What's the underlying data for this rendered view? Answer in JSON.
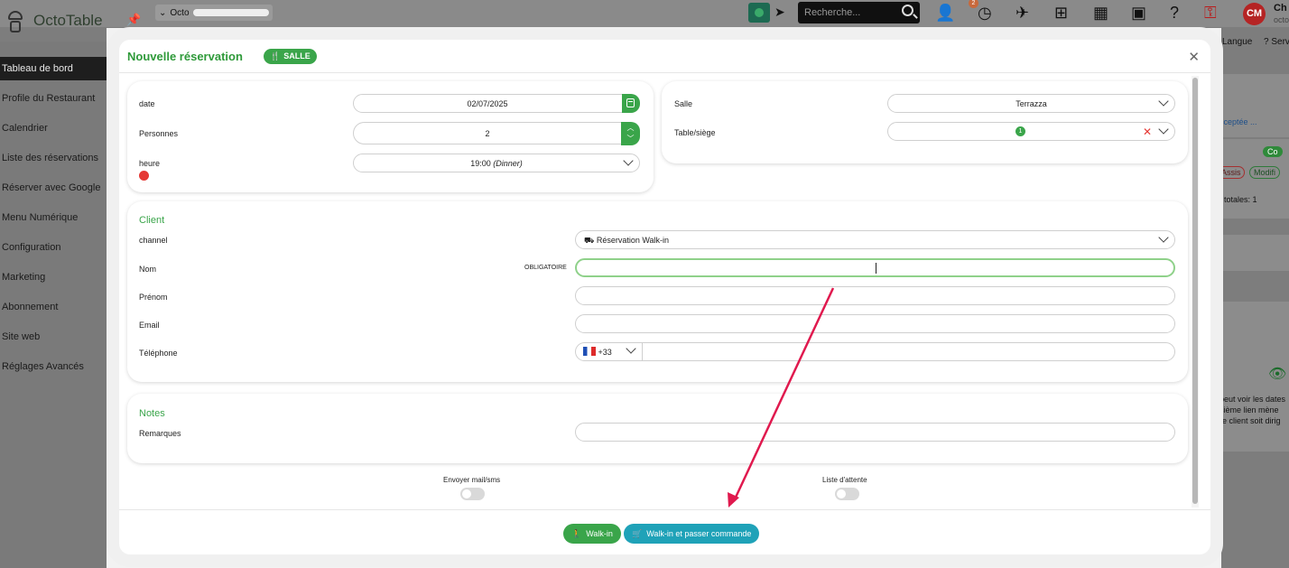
{
  "app": {
    "brand": "OctoTable",
    "tenant_prefix": "Octo",
    "search_placeholder": "Recherche...",
    "notification_count": "2",
    "avatar_initials": "CM",
    "user_name": "Ch",
    "user_sub": "octo",
    "pin_icon": "pin-icon",
    "right_menu": {
      "langue": "Langue",
      "serv": "? Serv"
    }
  },
  "sidebar": {
    "items": [
      {
        "label": "Tableau de bord",
        "active": true
      },
      {
        "label": "Profile du Restaurant"
      },
      {
        "label": "Calendrier"
      },
      {
        "label": "Liste des réservations"
      },
      {
        "label": "Réserver avec Google"
      },
      {
        "label": "Menu Numérique"
      },
      {
        "label": "Configuration"
      },
      {
        "label": "Marketing"
      },
      {
        "label": "Abonnement"
      },
      {
        "label": "Site web"
      },
      {
        "label": "Réglages Avancés"
      }
    ]
  },
  "background": {
    "acceptee": "cceptée ...",
    "co": "Co",
    "assis": "Assis",
    "modifier": "Modifi",
    "totales": "s totales: 1",
    "desc1": "peut voir les dates",
    "desc2": "sième lien mène",
    "desc3": "re client soit dirig"
  },
  "modal": {
    "title": "Nouvelle réservation",
    "badge": "SALLE",
    "close": "✕",
    "booking": {
      "date_label": "date",
      "date_value": "02/07/2025",
      "persons_label": "Personnes",
      "persons_value": "2",
      "time_label": "heure",
      "time_value": "19:00",
      "time_service": "(Dinner)"
    },
    "room": {
      "salle_label": "Salle",
      "salle_value": "Terrazza",
      "table_label": "Table/siège",
      "table_value": "1"
    },
    "client": {
      "title": "Client",
      "channel_label": "channel",
      "channel_value": "Réservation Walk-in",
      "nom_label": "Nom",
      "required_tag": "OBLIGATOIRE",
      "nom_value": "",
      "prenom_label": "Prénom",
      "prenom_value": "",
      "email_label": "Email",
      "email_value": "",
      "phone_label": "Téléphone",
      "phone_prefix": "+33",
      "phone_value": ""
    },
    "notes": {
      "title": "Notes",
      "remarques_label": "Remarques",
      "remarques_value": ""
    },
    "toggles": {
      "send_label": "Envoyer mail/sms",
      "send_on": false,
      "waitlist_label": "Liste d'attente",
      "waitlist_on": false
    },
    "footer": {
      "walkin_label": "Walk-in",
      "walkin_order_label": "Walk-in et passer commande"
    }
  },
  "colors": {
    "primary_green": "#3aa54a",
    "teal": "#1fa2b8",
    "annotation_arrow": "#e0194e",
    "danger": "#e53935"
  }
}
